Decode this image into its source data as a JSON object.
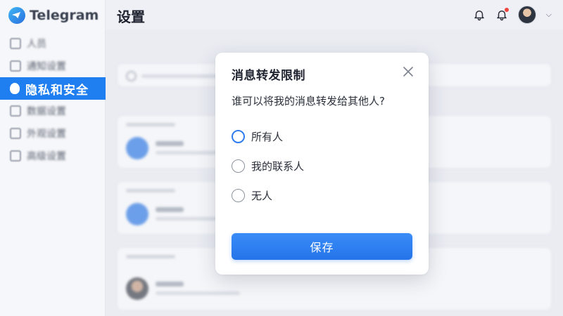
{
  "app": {
    "name": "Telegram"
  },
  "header": {
    "title": "设置"
  },
  "sidebar": {
    "items": [
      {
        "label": "人员",
        "icon": "home-icon"
      },
      {
        "label": "通知设置",
        "icon": "home-icon"
      },
      {
        "label": "隐私和安全",
        "icon": "lock-icon",
        "active": true
      },
      {
        "label": "数据设置",
        "icon": "gear-icon"
      },
      {
        "label": "外观设置",
        "icon": "palette-icon"
      },
      {
        "label": "高级设置",
        "icon": "settings-icon"
      }
    ]
  },
  "dialog": {
    "title": "消息转发限制",
    "question": "谁可以将我的消息转发给其他人?",
    "options": [
      {
        "label": "所有人",
        "selected": true
      },
      {
        "label": "我的联系人",
        "selected": false
      },
      {
        "label": "无人",
        "selected": false
      }
    ],
    "save_label": "保存"
  },
  "colors": {
    "accent": "#2e7cf0",
    "notification_dot": "#f0463c"
  }
}
